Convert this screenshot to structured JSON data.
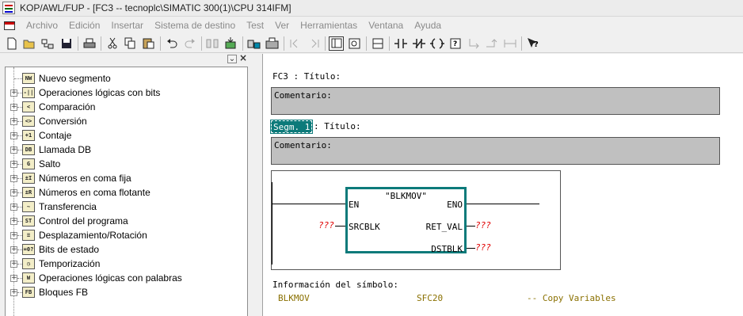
{
  "window": {
    "title": "KOP/AWL/FUP  - [FC3 -- tecnoplc\\SIMATIC 300(1)\\CPU 314IFM]"
  },
  "menu": [
    "Archivo",
    "Edición",
    "Insertar",
    "Sistema de destino",
    "Test",
    "Ver",
    "Herramientas",
    "Ventana",
    "Ayuda"
  ],
  "toolbar": {
    "icons": [
      "new-icon",
      "open-icon",
      "accessible-nodes-icon",
      "save-icon",
      "print-icon",
      "cut-icon",
      "copy-icon",
      "paste-icon",
      "undo-icon",
      "redo-icon",
      "load-icon",
      "download-icon",
      "online-offline-icon",
      "monitor-icon",
      "load-station-icon",
      "previous-segment-icon",
      "next-segment-icon",
      "overview-icon",
      "program-elements-icon",
      "new-network-icon",
      "normally-open-contact-icon",
      "normally-closed-contact-icon",
      "coil-icon",
      "empty-box-icon",
      "open-branch-icon",
      "close-branch-icon",
      "connection-icon",
      "help-icon"
    ]
  },
  "catalog": {
    "items": [
      {
        "label": "Nuevo segmento",
        "icon": "network-icon",
        "glyph": "NW"
      },
      {
        "label": "Operaciones lógicas con bits",
        "icon": "bit-logic-icon",
        "glyph": "-||"
      },
      {
        "label": "Comparación",
        "icon": "comparison-icon",
        "glyph": "<"
      },
      {
        "label": "Conversión",
        "icon": "conversion-icon",
        "glyph": "<>"
      },
      {
        "label": "Contaje",
        "icon": "counter-icon",
        "glyph": "+1"
      },
      {
        "label": "Llamada DB",
        "icon": "db-call-icon",
        "glyph": "DB"
      },
      {
        "label": "Salto",
        "icon": "jump-icon",
        "glyph": "G"
      },
      {
        "label": "Números en coma fija",
        "icon": "integer-math-icon",
        "glyph": "±I"
      },
      {
        "label": "Números en coma flotante",
        "icon": "floating-point-icon",
        "glyph": "±R"
      },
      {
        "label": "Transferencia",
        "icon": "move-icon",
        "glyph": "~"
      },
      {
        "label": "Control del programa",
        "icon": "program-control-icon",
        "glyph": "ST"
      },
      {
        "label": "Desplazamiento/Rotación",
        "icon": "shift-rotate-icon",
        "glyph": "≡"
      },
      {
        "label": "Bits de estado",
        "icon": "status-bits-icon",
        "glyph": "=0?"
      },
      {
        "label": "Temporización",
        "icon": "timer-icon",
        "glyph": "◷"
      },
      {
        "label": "Operaciones lógicas con palabras",
        "icon": "word-logic-icon",
        "glyph": "W"
      },
      {
        "label": "Bloques FB",
        "icon": "fb-blocks-icon",
        "glyph": "FB"
      }
    ]
  },
  "editor": {
    "block_title": "FC3 : Título:",
    "block_comment_label": "Comentario:",
    "segment_badge": "Segm. 1",
    "segment_title": ": Título:",
    "segment_comment_label": "Comentario:",
    "fb": {
      "name": "\"BLKMOV\"",
      "pins": {
        "en": "EN",
        "eno": "ENO",
        "srcblk": "SRCBLK",
        "ret_val": "RET_VAL",
        "dstblk": "DSTBLK"
      },
      "params": {
        "srcblk": "???",
        "ret_val": "???",
        "dstblk": "???"
      }
    },
    "symbol_info": {
      "header": "Información del símbolo:",
      "symbol": "BLKMOV",
      "address": "SFC20",
      "comment": "-- Copy Variables"
    },
    "colors": {
      "fb_border": "#0c7a7a",
      "segment_badge_bg": "#0c7a7a",
      "missing_param": "#e00000",
      "symbol_text": "#8a7000"
    }
  }
}
